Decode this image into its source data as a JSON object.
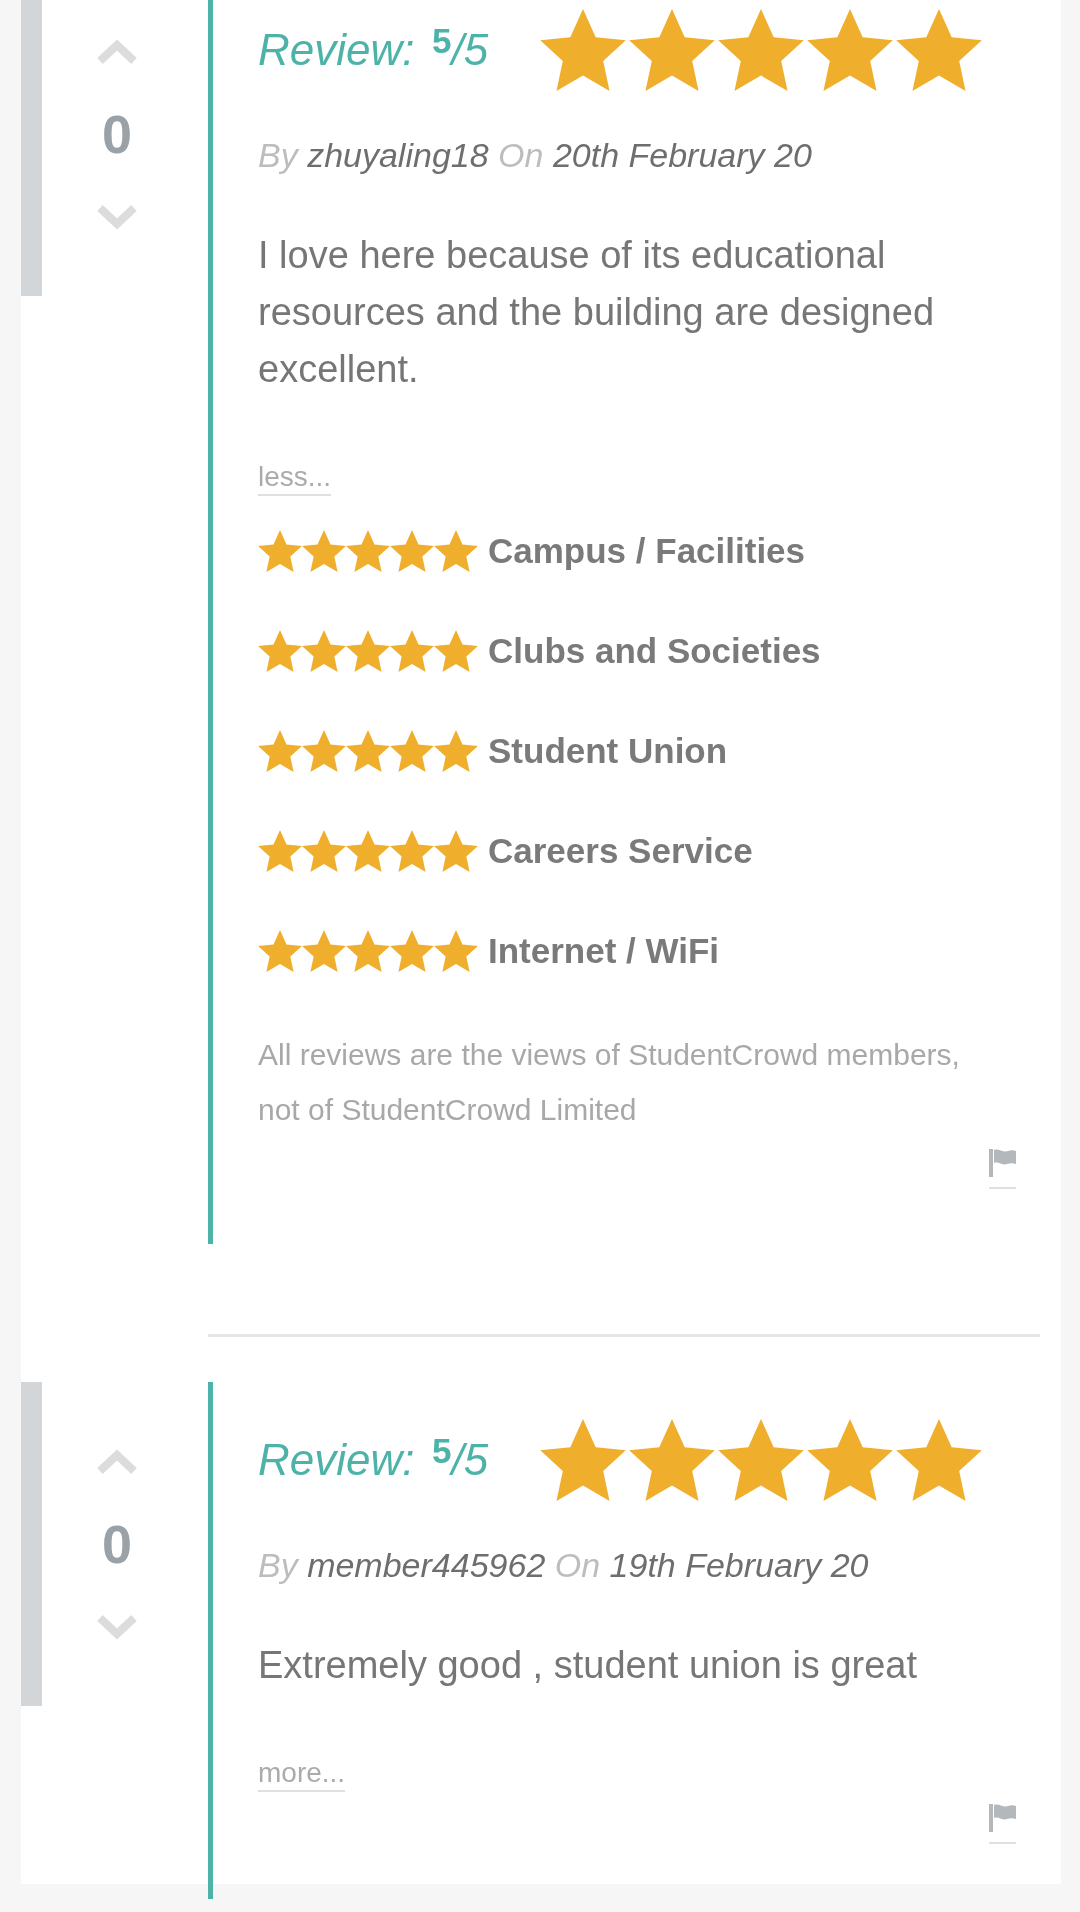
{
  "reviews": [
    {
      "votes": "0",
      "rating": "Review: $^{5}$/5",
      "stars": 5,
      "by_label": "By",
      "author": "zhuyaling18",
      "on_label": "On",
      "date": "20th February 20",
      "body": "I love here because of its educational resources and the building are designed excellent.",
      "toggle": "less...",
      "categories": [
        {
          "stars": 5,
          "label": "Campus / Facilities"
        },
        {
          "stars": 5,
          "label": "Clubs and Societies"
        },
        {
          "stars": 5,
          "label": "Student Union"
        },
        {
          "stars": 5,
          "label": "Careers Service"
        },
        {
          "stars": 5,
          "label": "Internet / WiFi"
        }
      ],
      "disclaimer": "All reviews are the views of StudentCrowd members, not of StudentCrowd Limited"
    },
    {
      "votes": "0",
      "rating": "Review: $^{5}$/5",
      "stars": 5,
      "by_label": "By",
      "author": "member445962",
      "on_label": "On",
      "date": "19th February 20",
      "body": "Extremely good , student union is great",
      "toggle": "more..."
    }
  ]
}
